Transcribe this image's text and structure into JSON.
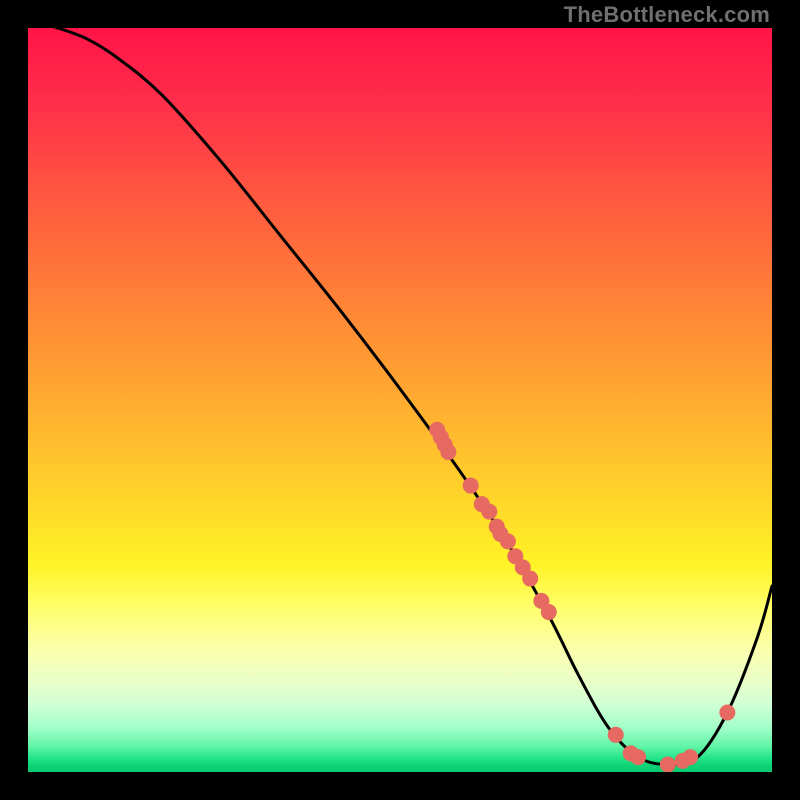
{
  "watermark": "TheBottleneck.com",
  "chart_data": {
    "type": "line",
    "title": "",
    "xlabel": "",
    "ylabel": "",
    "xlim": [
      0,
      100
    ],
    "ylim": [
      0,
      100
    ],
    "grid": false,
    "legend": false,
    "series": [
      {
        "name": "curve",
        "x": [
          0,
          4,
          8,
          12,
          18,
          26,
          34,
          42,
          50,
          58,
          64,
          70,
          74,
          78,
          82,
          86,
          90,
          94,
          98,
          100
        ],
        "y": [
          101,
          100,
          98.5,
          96,
          91,
          82,
          72,
          62,
          51.5,
          40.5,
          31.5,
          21,
          13,
          6,
          2,
          1,
          2,
          8,
          18,
          25
        ]
      }
    ],
    "points": [
      {
        "x": 55,
        "y": 46
      },
      {
        "x": 55.5,
        "y": 45
      },
      {
        "x": 56,
        "y": 44
      },
      {
        "x": 56.5,
        "y": 43
      },
      {
        "x": 59.5,
        "y": 38.5
      },
      {
        "x": 61,
        "y": 36
      },
      {
        "x": 62,
        "y": 35
      },
      {
        "x": 63,
        "y": 33
      },
      {
        "x": 63.5,
        "y": 32
      },
      {
        "x": 64.5,
        "y": 31
      },
      {
        "x": 65.5,
        "y": 29
      },
      {
        "x": 66.5,
        "y": 27.5
      },
      {
        "x": 67.5,
        "y": 26
      },
      {
        "x": 69,
        "y": 23
      },
      {
        "x": 70,
        "y": 21.5
      },
      {
        "x": 79,
        "y": 5
      },
      {
        "x": 81,
        "y": 2.5
      },
      {
        "x": 82,
        "y": 2
      },
      {
        "x": 86,
        "y": 1
      },
      {
        "x": 88,
        "y": 1.5
      },
      {
        "x": 89,
        "y": 2
      },
      {
        "x": 94,
        "y": 8
      }
    ],
    "point_color": "#e66a61",
    "line_color": "#000000"
  }
}
